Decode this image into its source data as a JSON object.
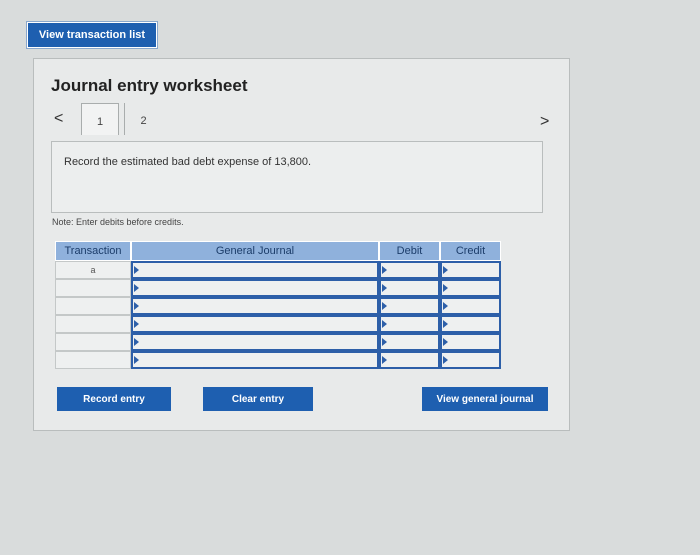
{
  "top_button": {
    "label": "View transaction list"
  },
  "worksheet": {
    "title": "Journal entry worksheet",
    "prev_symbol": "<",
    "next_symbol": ">",
    "tabs": [
      {
        "label": "1"
      },
      {
        "label": "2"
      }
    ],
    "instruction": "Record the estimated bad debt expense of 13,800.",
    "note": "Note: Enter debits before credits."
  },
  "table": {
    "headers": {
      "transaction": "Transaction",
      "general_journal": "General Journal",
      "debit": "Debit",
      "credit": "Credit"
    },
    "rows": [
      {
        "transaction": "a"
      },
      {
        "transaction": ""
      },
      {
        "transaction": ""
      },
      {
        "transaction": ""
      },
      {
        "transaction": ""
      },
      {
        "transaction": ""
      }
    ]
  },
  "buttons": {
    "record": "Record entry",
    "clear": "Clear entry",
    "view_journal": "View general journal"
  },
  "colors": {
    "button_blue": "#1e5fb0",
    "header_blue": "#8fb1dc",
    "input_border": "#2d5fa8"
  }
}
